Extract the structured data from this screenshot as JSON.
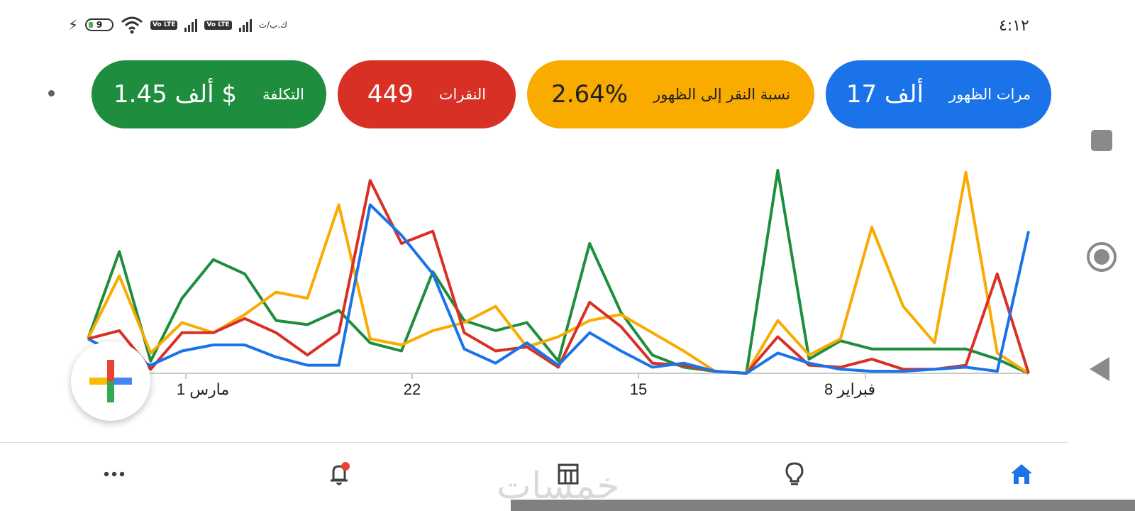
{
  "status_bar": {
    "time": "٤:١٢",
    "battery_level": "9",
    "net_speed": "ك.ب/ث",
    "network_badges": [
      "Vo LTE",
      "Vo LTE"
    ]
  },
  "metrics": [
    {
      "id": "impressions",
      "label": "مرات الظهور",
      "value": "17 ألف",
      "color": "#1a73e8"
    },
    {
      "id": "ctr",
      "label": "نسبة النقر إلى الظهور",
      "value": "2.64%",
      "color": "#f9ab00"
    },
    {
      "id": "clicks",
      "label": "النقرات",
      "value": "449",
      "color": "#d93025"
    },
    {
      "id": "cost",
      "label": "التكلفة",
      "value": "1.45 ألف $",
      "color": "#1e8e3e"
    }
  ],
  "chart_data": {
    "type": "line",
    "x_ticks": [
      "مارس 1",
      "22",
      "15",
      "فبراير 8"
    ],
    "x_direction": "right-to-left (latest date at left)",
    "points_per_series": 31,
    "y_scale": "relative 0-1, unlabeled",
    "series": [
      {
        "name": "مرات الظهور",
        "color": "#1a73e8",
        "values": [
          0.17,
          0.09,
          0.04,
          0.11,
          0.14,
          0.14,
          0.08,
          0.04,
          0.04,
          0.83,
          0.68,
          0.49,
          0.12,
          0.05,
          0.15,
          0.04,
          0.2,
          0.11,
          0.03,
          0.05,
          0.01,
          0.0,
          0.1,
          0.05,
          0.02,
          0.01,
          0.01,
          0.02,
          0.03,
          0.01,
          0.7
        ]
      },
      {
        "name": "نسبة النقر إلى الظهور",
        "color": "#f9ab00",
        "values": [
          0.17,
          0.48,
          0.1,
          0.25,
          0.2,
          0.29,
          0.4,
          0.37,
          0.83,
          0.17,
          0.14,
          0.21,
          0.25,
          0.33,
          0.13,
          0.18,
          0.26,
          0.29,
          0.2,
          0.11,
          0.01,
          0.0,
          0.26,
          0.09,
          0.17,
          0.72,
          0.33,
          0.15,
          0.99,
          0.1,
          0.0
        ]
      },
      {
        "name": "النقرات",
        "color": "#d93025",
        "values": [
          0.17,
          0.21,
          0.02,
          0.2,
          0.2,
          0.27,
          0.2,
          0.09,
          0.2,
          0.95,
          0.64,
          0.7,
          0.2,
          0.11,
          0.13,
          0.03,
          0.35,
          0.23,
          0.05,
          0.04,
          0.01,
          0.0,
          0.18,
          0.04,
          0.03,
          0.07,
          0.02,
          0.02,
          0.04,
          0.49,
          0.0
        ]
      },
      {
        "name": "التكلفة",
        "color": "#1e8e3e",
        "values": [
          0.17,
          0.6,
          0.06,
          0.37,
          0.56,
          0.49,
          0.26,
          0.24,
          0.31,
          0.15,
          0.11,
          0.5,
          0.26,
          0.21,
          0.25,
          0.06,
          0.64,
          0.3,
          0.09,
          0.03,
          0.01,
          0.0,
          1.0,
          0.07,
          0.16,
          0.12,
          0.12,
          0.12,
          0.12,
          0.07,
          0.0
        ]
      }
    ]
  },
  "fab": {
    "icon": "add-plus-icon"
  },
  "bottom_nav": [
    {
      "id": "home",
      "icon": "home-icon",
      "active": true,
      "color": "#1a73e8"
    },
    {
      "id": "recommendations",
      "icon": "lightbulb-icon",
      "active": false
    },
    {
      "id": "campaigns",
      "icon": "table-icon",
      "active": false
    },
    {
      "id": "notifications",
      "icon": "bell-icon",
      "active": false,
      "badge": true
    },
    {
      "id": "more",
      "icon": "more-dots-icon",
      "active": false
    }
  ],
  "watermark": "خمسات"
}
